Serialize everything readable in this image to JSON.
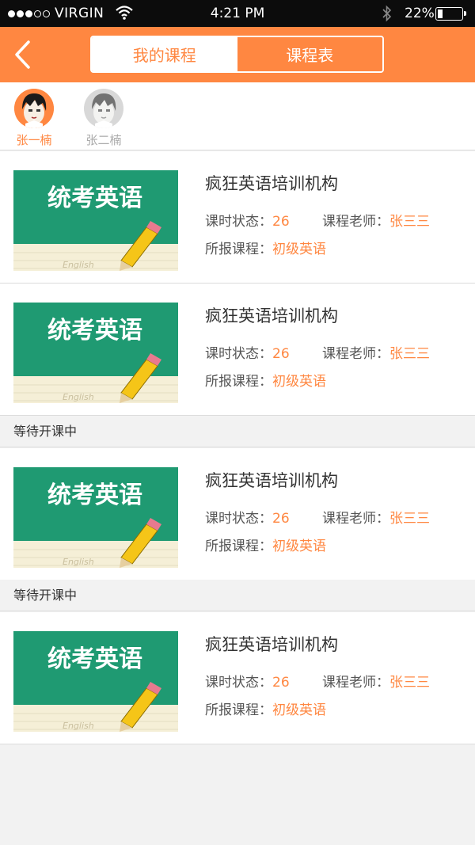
{
  "status_bar": {
    "carrier": "VIRGIN",
    "signal_icon": "signal-dots-icon",
    "wifi_icon": "wifi-icon",
    "time": "4:21 PM",
    "bluetooth_icon": "bluetooth-icon",
    "battery_percent": "22%",
    "battery_level": 0.22
  },
  "navbar": {
    "back_icon": "chevron-left-icon",
    "tabs": [
      {
        "label": "我的课程",
        "active": true
      },
      {
        "label": "课程表",
        "active": false
      }
    ]
  },
  "students": [
    {
      "name": "张一楠",
      "selected": true
    },
    {
      "name": "张二楠",
      "selected": false
    }
  ],
  "thumbnail": {
    "text": "统考英语",
    "subtext": "English"
  },
  "courses": [
    {
      "institution": "疯狂英语培训机构",
      "hours_label": "课时状态：",
      "hours": "26",
      "teacher_label": "课程老师：",
      "teacher": "张三三",
      "course_label": "所报课程：",
      "course": "初级英语"
    },
    {
      "institution": "疯狂英语培训机构",
      "hours_label": "课时状态：",
      "hours": "26",
      "teacher_label": "课程老师：",
      "teacher": "张三三",
      "course_label": "所报课程：",
      "course": "初级英语"
    },
    {
      "institution": "疯狂英语培训机构",
      "hours_label": "课时状态：",
      "hours": "26",
      "teacher_label": "课程老师：",
      "teacher": "张三三",
      "course_label": "所报课程：",
      "course": "初级英语"
    },
    {
      "institution": "疯狂英语培训机构",
      "hours_label": "课时状态：",
      "hours": "26",
      "teacher_label": "课程老师：",
      "teacher": "张三三",
      "course_label": "所报课程：",
      "course": "初级英语"
    }
  ],
  "sections": [
    {
      "label": "等待开课中"
    },
    {
      "label": "等待开课中"
    }
  ],
  "colors": {
    "accent": "#ff8741",
    "chalkboard": "#1f9a72",
    "status_bar": "#0c0c0c"
  }
}
